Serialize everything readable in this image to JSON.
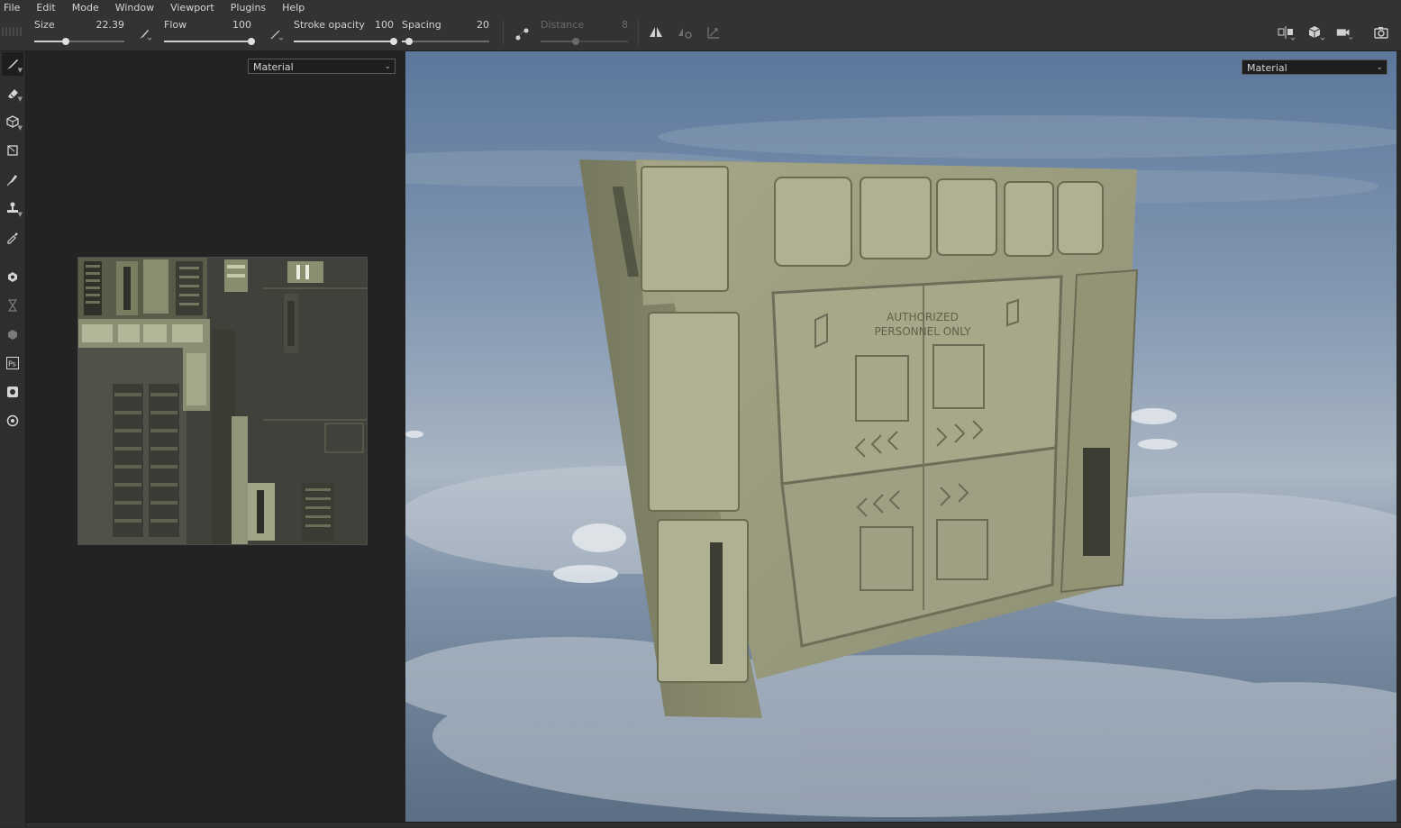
{
  "menu": [
    "File",
    "Edit",
    "Mode",
    "Window",
    "Viewport",
    "Plugins",
    "Help"
  ],
  "toolbar": {
    "size": {
      "label": "Size",
      "value": "22.39",
      "fraction": 0.35
    },
    "flow": {
      "label": "Flow",
      "value": "100",
      "fraction": 1.0
    },
    "stroke_opacity": {
      "label": "Stroke opacity",
      "value": "100",
      "fraction": 1.0
    },
    "spacing": {
      "label": "Spacing",
      "value": "20",
      "fraction": 0.08
    },
    "distance": {
      "label": "Distance",
      "value": "8",
      "fraction": 0.4
    }
  },
  "uv_panel": {
    "dropdown": "Material"
  },
  "viewport": {
    "dropdown": "Material",
    "decal_text_line1": "AUTHORIZED",
    "decal_text_line2": "PERSONNEL ONLY"
  },
  "colors": {
    "panel_olive": "#9a9b7c",
    "panel_dark": "#6d6e55",
    "sky_top": "#5f7ba0",
    "cloud": "#c9d0d8"
  }
}
